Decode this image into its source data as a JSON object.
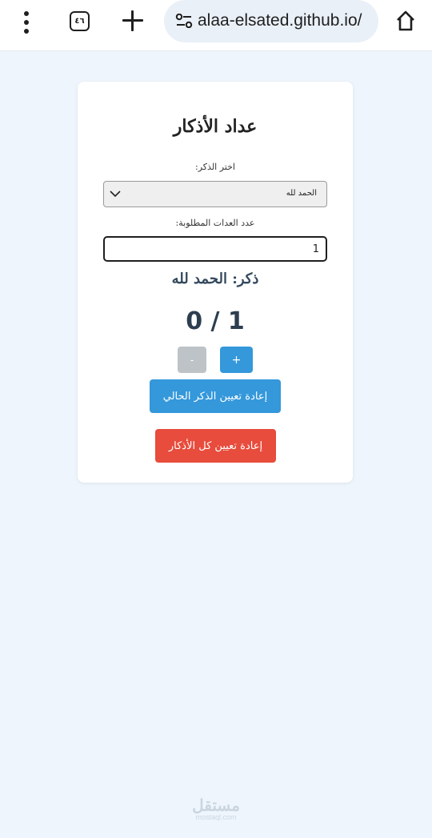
{
  "browser": {
    "tab_count": "٤٦",
    "url": "alaa-elsated.github.io/",
    "icons": [
      "more-vert-icon",
      "tabs-icon",
      "plus-icon",
      "site-settings-icon",
      "home-icon"
    ]
  },
  "app": {
    "title": "عداد الأذكار",
    "select_label": "اختر الذكر:",
    "selected_dhikr": "الحمد لله",
    "count_label": "عدد العدات المطلوبة:",
    "count_value": "1",
    "current_dhikr_text": "ذكر: الحمد لله",
    "counter_text": "0 / 1",
    "plus_label": "+",
    "minus_label": "-",
    "reset_current_label": "إعادة تعيين الذكر الحالي",
    "reset_all_label": "إعادة تعيين كل الأذكار"
  },
  "colors": {
    "background": "#eef5fd",
    "primary_button": "#3498db",
    "danger_button": "#e74c3c",
    "disabled_button": "#bdc3c7"
  },
  "watermark": {
    "main": "مستقل",
    "sub": "mostaql.com"
  }
}
